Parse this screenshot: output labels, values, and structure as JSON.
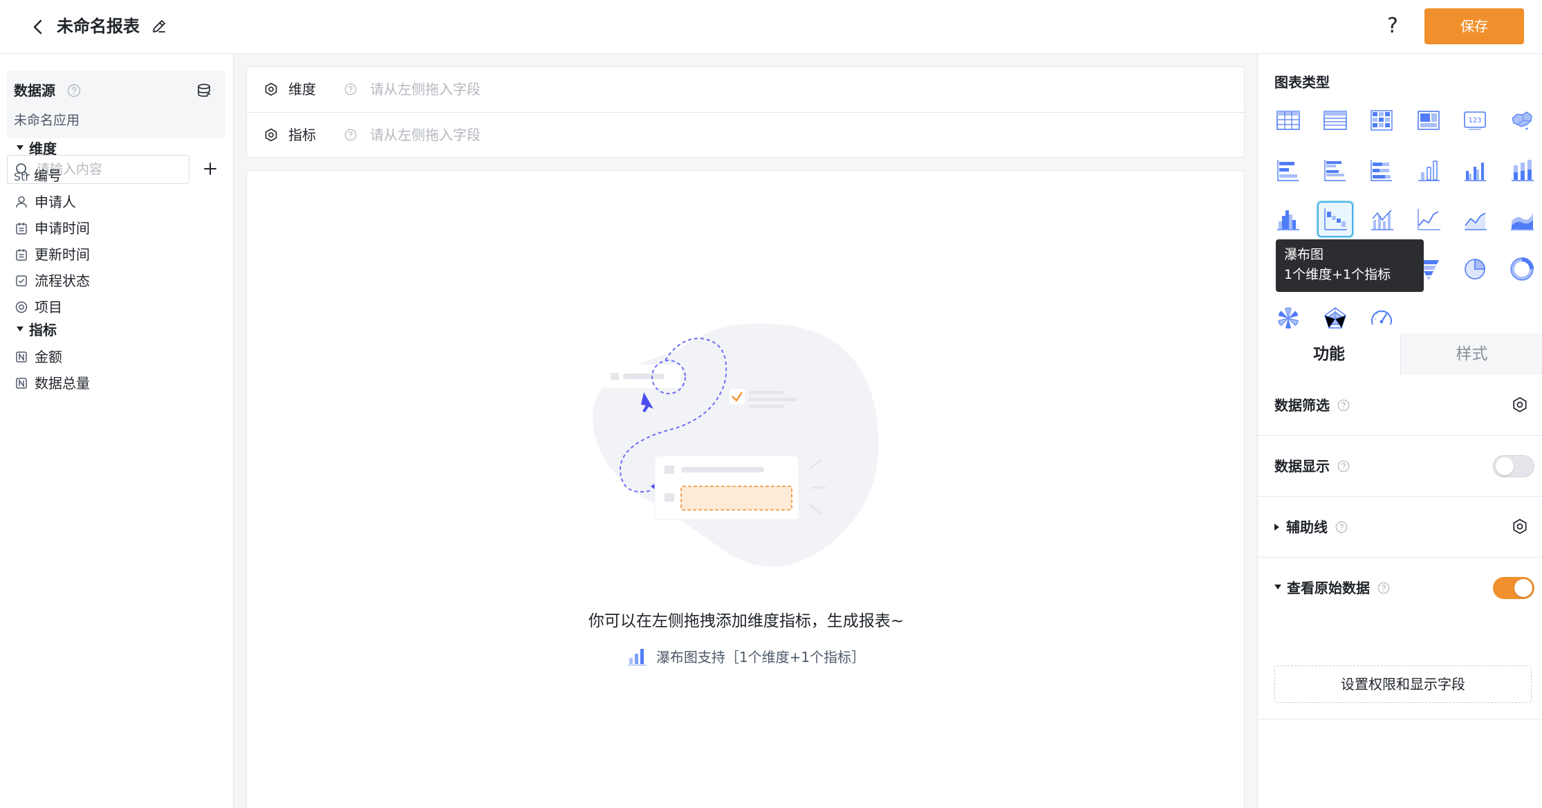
{
  "header": {
    "title": "未命名报表",
    "help_label": "?",
    "save_label": "保存"
  },
  "left": {
    "datasource": {
      "title": "数据源",
      "app_name": "未命名应用"
    },
    "search": {
      "placeholder": "请输入内容"
    },
    "dimension_group": {
      "label": "维度",
      "fields": [
        {
          "type_prefix": "Str",
          "label": "编号",
          "icon": "string-icon"
        },
        {
          "label": "申请人",
          "icon": "person-icon"
        },
        {
          "label": "申请时间",
          "icon": "calendar-icon"
        },
        {
          "label": "更新时间",
          "icon": "calendar-icon"
        },
        {
          "label": "流程状态",
          "icon": "checkbox-icon"
        },
        {
          "label": "项目",
          "icon": "radio-icon"
        }
      ]
    },
    "metric_group": {
      "label": "指标",
      "fields": [
        {
          "label": "金额",
          "icon": "number-icon"
        },
        {
          "label": "数据总量",
          "icon": "number-icon"
        }
      ]
    }
  },
  "center": {
    "dimension_slot": {
      "label": "维度",
      "placeholder": "请从左侧拖入字段"
    },
    "metric_slot": {
      "label": "指标",
      "placeholder": "请从左侧拖入字段"
    },
    "empty_text": "你可以在左侧拖拽添加维度指标，生成报表~",
    "hint_text": "瀑布图支持［1个维度+1个指标］"
  },
  "right": {
    "chart_type_title": "图表类型",
    "chart_types": [
      "table",
      "list-table",
      "pivot-table",
      "card-table",
      "number-card",
      "map",
      "bar-horizontal",
      "bar-horizontal-grouped",
      "bar-horizontal-stacked",
      "column",
      "column-grouped",
      "column-stacked",
      "histogram",
      "waterfall",
      "column-line-combo",
      "line",
      "area-line",
      "area",
      "scatter",
      "bubble",
      "dot-line",
      "funnel",
      "pie",
      "donut",
      "rose",
      "radar",
      "gauge"
    ],
    "selected_chart": "waterfall",
    "tooltip": {
      "title": "瀑布图",
      "desc": "1个维度+1个指标"
    },
    "tabs": {
      "function": "功能",
      "style": "样式"
    },
    "data_filter": {
      "label": "数据筛选"
    },
    "data_display": {
      "label": "数据显示",
      "enabled": false
    },
    "aux_line": {
      "label": "辅助线"
    },
    "view_raw": {
      "label": "查看原始数据",
      "enabled": true
    },
    "perm_button": "设置权限和显示字段",
    "colors": {
      "accent": "#f0902c",
      "chart_icon": "#4f7cf7",
      "selected_border": "#45b0e6"
    }
  }
}
